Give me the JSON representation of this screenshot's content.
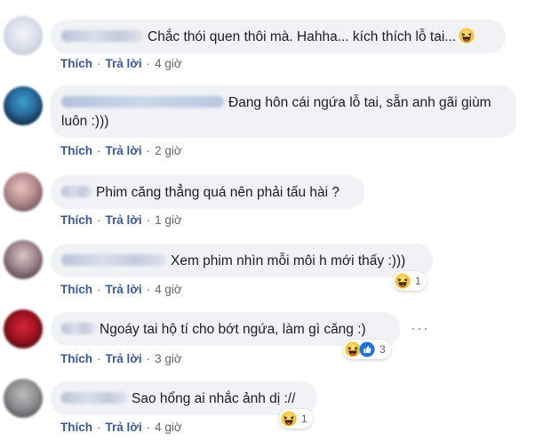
{
  "comments": [
    {
      "text": "Chắc thói quen thôi mà. Hahha... kích thích lỗ tai...",
      "trailing_emoji": "haha-emoji",
      "actions": {
        "like": "Thích",
        "reply": "Trả lời",
        "time": "4 giờ"
      },
      "reactions": null
    },
    {
      "text_line1": "Đang hôn cái ngứa lỗ tai, sẵn anh gãi giùm",
      "text_line2": "luôn :)))",
      "actions": {
        "like": "Thích",
        "reply": "Trả lời",
        "time": "2 giờ"
      },
      "reactions": null
    },
    {
      "text": "Phim căng thẳng quá nên phải tấu hài ?",
      "actions": {
        "like": "Thích",
        "reply": "Trả lời",
        "time": "1 giờ"
      },
      "reactions": null
    },
    {
      "text": "Xem phim nhìn mỗi môi h mới thấy :)))",
      "actions": {
        "like": "Thích",
        "reply": "Trả lời",
        "time": "4 giờ"
      },
      "reactions": {
        "icons": [
          "haha-emoji"
        ],
        "count": "1"
      }
    },
    {
      "text": "Ngoáy tai hộ tí cho bớt ngứa, làm gì căng :)",
      "actions": {
        "like": "Thích",
        "reply": "Trả lời",
        "time": "3 giờ"
      },
      "reactions": {
        "icons": [
          "haha-emoji",
          "like-emoji"
        ],
        "count": "3"
      },
      "more_options": "···"
    },
    {
      "text": "Sao hổng ai nhắc ảnh dị ://",
      "actions": {
        "like": "Thích",
        "reply": "Trả lời",
        "time": "4 giờ"
      },
      "reactions": {
        "icons": [
          "haha-emoji"
        ],
        "count": "1"
      }
    }
  ],
  "colors": {
    "bubble": "#f0f2f5",
    "link": "#385898",
    "meta": "#65676b",
    "text": "#1c1e21"
  }
}
